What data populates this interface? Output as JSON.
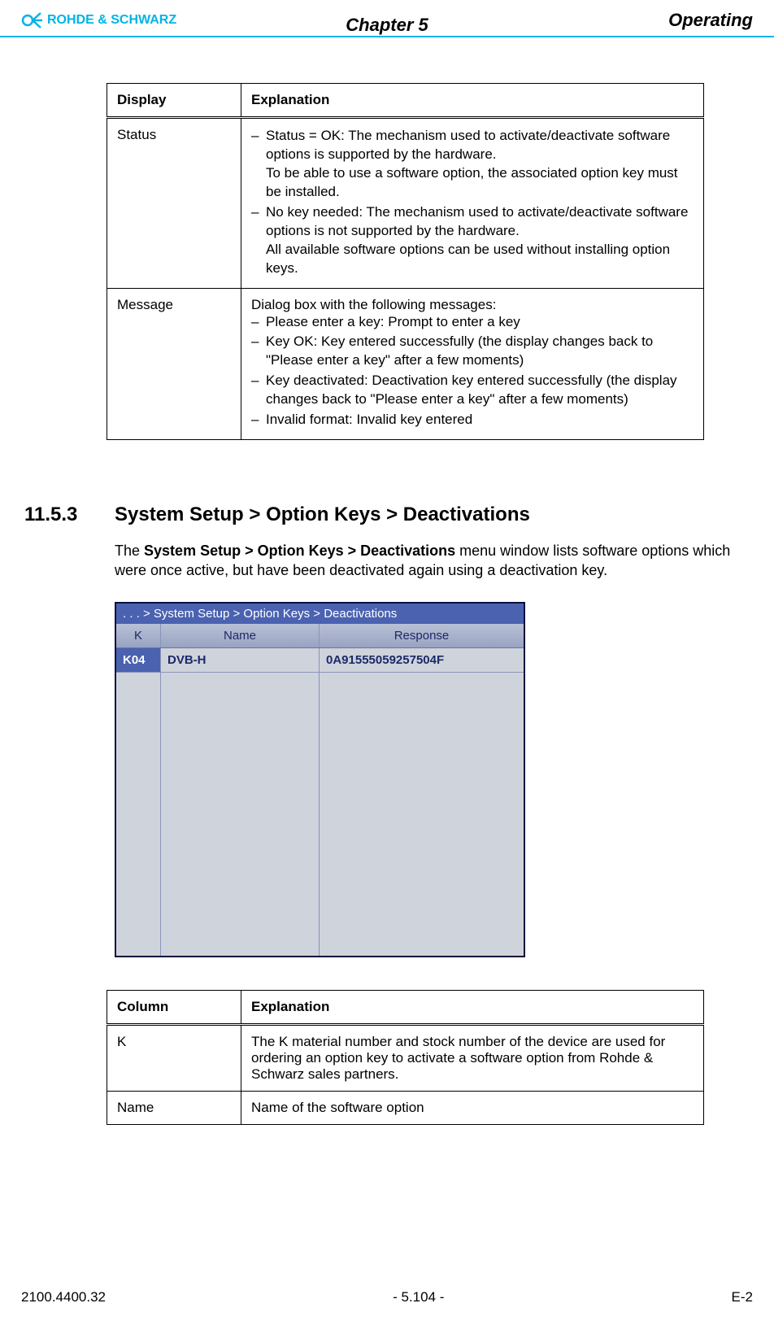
{
  "header": {
    "brand": "ROHDE & SCHWARZ",
    "chapter": "Chapter 5",
    "section": "Operating"
  },
  "table1": {
    "h1": "Display",
    "h2": "Explanation",
    "rows": [
      {
        "c1": "Status",
        "c2_items": [
          "Status = OK: The mechanism used to activate/deactivate software options is supported by the hardware.",
          "To be able to use a software option, the associated option key must be installed.",
          "No key needed: The mechanism used to activate/deactivate software options is not supported by the hardware.",
          "All available software options can be used without installing option keys."
        ]
      },
      {
        "c1": "Message",
        "c2_intro": "Dialog box with the following messages:",
        "c2_items": [
          "Please enter a key: Prompt to enter a key",
          "Key OK: Key entered successfully (the display changes back to \"Please enter a key\" after a few moments)",
          "Key deactivated: Deactivation key entered successfully (the display changes back to \"Please enter a key\" after a few moments)",
          "Invalid format: Invalid key entered"
        ]
      }
    ]
  },
  "section_header": {
    "num": "11.5.3",
    "title": "System Setup > Option Keys > Deactivations"
  },
  "paragraph": {
    "pre": "The ",
    "bold": "System Setup > Option Keys > Deactivations",
    "post": " menu window lists software options which were once active, but have been deactivated again using a deactivation key."
  },
  "screenshot": {
    "title": ". . .  > System Setup > Option Keys > Deactivations",
    "cols": {
      "k": "K",
      "name": "Name",
      "resp": "Response"
    },
    "row": {
      "k": "K04",
      "name": "DVB-H",
      "resp": "0A91555059257504F"
    }
  },
  "table2": {
    "h1": "Column",
    "h2": "Explanation",
    "rows": [
      {
        "c1": "K",
        "c2": "The K material number and stock number of the device are used for ordering an option key to activate a software option from Rohde & Schwarz sales partners."
      },
      {
        "c1": "Name",
        "c2": "Name of the software option"
      }
    ]
  },
  "footer": {
    "left": "2100.4400.32",
    "center": "- 5.104 -",
    "right": "E-2"
  }
}
